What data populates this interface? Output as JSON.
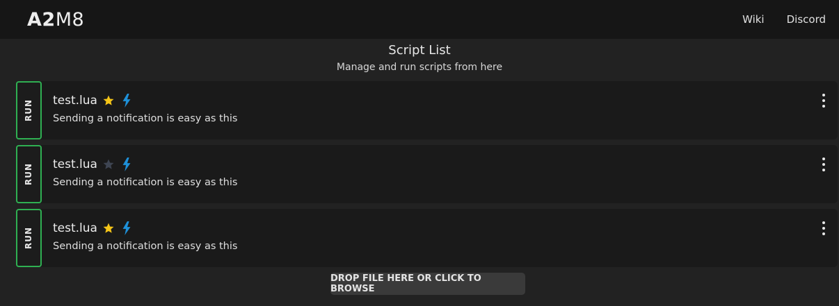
{
  "brand": {
    "bold": "A2",
    "light": "M8"
  },
  "nav": {
    "wiki": "Wiki",
    "discord": "Discord"
  },
  "header": {
    "title": "Script List",
    "subtitle": "Manage and run scripts from here"
  },
  "colors": {
    "run_border": "#2fb052",
    "star_active": "#f5c518",
    "star_inactive": "#3e4552",
    "bolt": "#1e90d8"
  },
  "scripts": [
    {
      "run_label": "RUN",
      "name": "test.lua",
      "description": "Sending a notification is easy as this",
      "favorite": true,
      "icons": [
        "star-icon",
        "bolt-icon",
        "more-vertical-icon"
      ]
    },
    {
      "run_label": "RUN",
      "name": "test.lua",
      "description": "Sending a notification is easy as this",
      "favorite": false,
      "icons": [
        "star-icon",
        "bolt-icon",
        "more-vertical-icon"
      ]
    },
    {
      "run_label": "RUN",
      "name": "test.lua",
      "description": "Sending a notification is easy as this",
      "favorite": true,
      "icons": [
        "star-icon",
        "bolt-icon",
        "more-vertical-icon"
      ]
    }
  ],
  "dropzone": {
    "label": "DROP FILE HERE OR CLICK TO BROWSE"
  }
}
